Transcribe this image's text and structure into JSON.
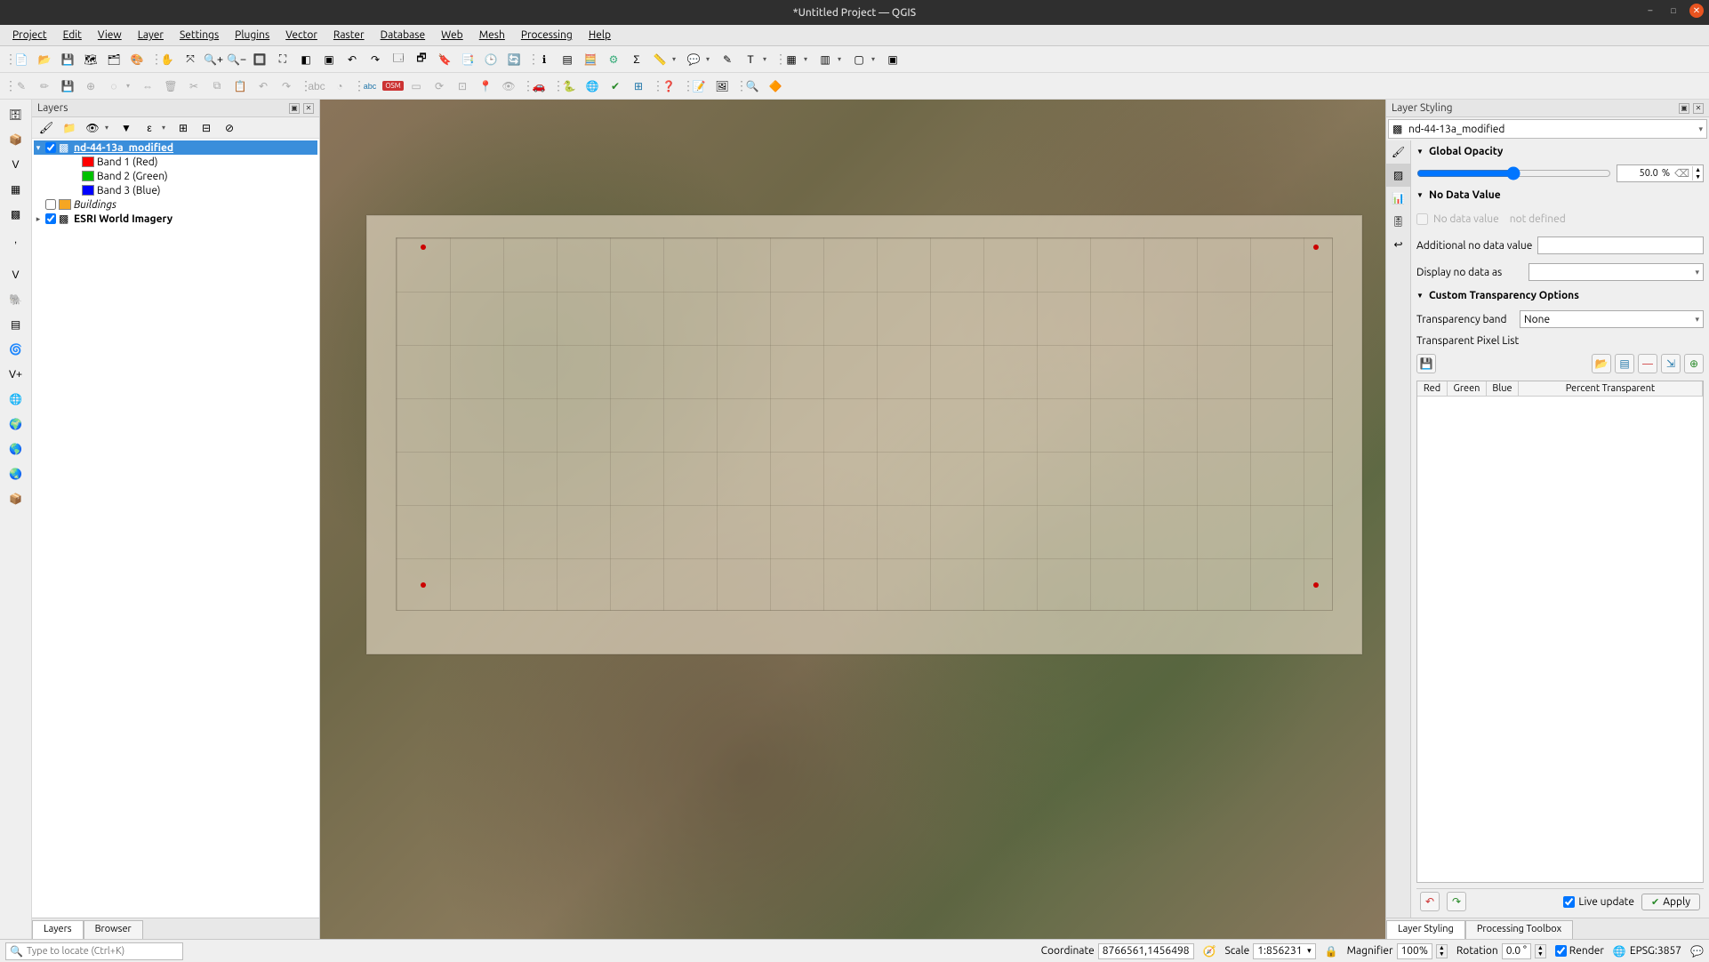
{
  "window": {
    "title": "*Untitled Project — QGIS"
  },
  "menu": [
    "Project",
    "Edit",
    "View",
    "Layer",
    "Settings",
    "Plugins",
    "Vector",
    "Raster",
    "Database",
    "Web",
    "Mesh",
    "Processing",
    "Help"
  ],
  "panels": {
    "layers_title": "Layers",
    "styling_title": "Layer Styling"
  },
  "layers": {
    "items": [
      {
        "name": "nd-44-13a_modified",
        "checked": true,
        "selected": true,
        "type": "raster",
        "children": [
          {
            "name": "Band 1 (Red)",
            "color": "#ff0000"
          },
          {
            "name": "Band 2 (Green)",
            "color": "#00c000"
          },
          {
            "name": "Band 3 (Blue)",
            "color": "#0000ff"
          }
        ]
      },
      {
        "name": "Buildings",
        "checked": false,
        "type": "vector",
        "color": "#f5a623",
        "italic": true
      },
      {
        "name": "ESRI World Imagery",
        "checked": true,
        "type": "raster"
      }
    ],
    "tabs": {
      "layers": "Layers",
      "browser": "Browser"
    }
  },
  "styling": {
    "layer": "nd-44-13a_modified",
    "sections": {
      "opacity": {
        "title": "Global Opacity",
        "value": "50.0",
        "unit": "%"
      },
      "nodata": {
        "title": "No Data Value",
        "checkbox_label": "No data value",
        "checkbox_info": "not defined",
        "additional_label": "Additional no data value",
        "display_label": "Display no data as"
      },
      "custom": {
        "title": "Custom Transparency Options",
        "band_label": "Transparency band",
        "band_value": "None",
        "pixel_label": "Transparent Pixel List",
        "cols": {
          "red": "Red",
          "green": "Green",
          "blue": "Blue",
          "pct": "Percent Transparent"
        }
      }
    },
    "live_update_label": "Live update",
    "apply_label": "Apply",
    "bottom_tabs": {
      "styling": "Layer Styling",
      "toolbox": "Processing Toolbox"
    }
  },
  "status": {
    "search_placeholder": "Type to locate (Ctrl+K)",
    "coordinate_label": "Coordinate",
    "coordinate": "8766561,1456498",
    "scale_label": "Scale",
    "scale": "1:856231",
    "magnifier_label": "Magnifier",
    "magnifier": "100%",
    "rotation_label": "Rotation",
    "rotation": "0.0 °",
    "render_label": "Render",
    "crs": "EPSG:3857"
  }
}
